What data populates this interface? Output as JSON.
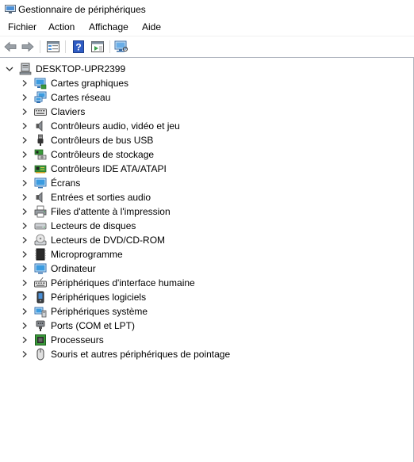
{
  "window": {
    "title": "Gestionnaire de périphériques"
  },
  "menu": [
    {
      "label": "Fichier"
    },
    {
      "label": "Action"
    },
    {
      "label": "Affichage"
    },
    {
      "label": "Aide"
    }
  ],
  "toolbar": {
    "buttons": [
      {
        "icon": "back-arrow-icon"
      },
      {
        "icon": "forward-arrow-icon"
      },
      {
        "icon": "properties-icon"
      },
      {
        "icon": "help-icon"
      },
      {
        "icon": "view-icon"
      },
      {
        "icon": "monitor-scan-icon"
      }
    ]
  },
  "tree": {
    "root": {
      "label": "DESKTOP-UPR2399",
      "expanded": true
    },
    "items": [
      {
        "label": "Cartes graphiques",
        "icon": "display-adapter-icon"
      },
      {
        "label": "Cartes réseau",
        "icon": "network-adapter-icon"
      },
      {
        "label": "Claviers",
        "icon": "keyboard-icon"
      },
      {
        "label": "Contrôleurs audio, vidéo et jeu",
        "icon": "speaker-icon"
      },
      {
        "label": "Contrôleurs de bus USB",
        "icon": "usb-icon"
      },
      {
        "label": "Contrôleurs de stockage",
        "icon": "storage-controller-icon"
      },
      {
        "label": "Contrôleurs IDE ATA/ATAPI",
        "icon": "ide-controller-icon"
      },
      {
        "label": "Écrans",
        "icon": "monitor-icon"
      },
      {
        "label": "Entrées et sorties audio",
        "icon": "audio-io-icon"
      },
      {
        "label": "Files d'attente à l'impression",
        "icon": "printer-icon"
      },
      {
        "label": "Lecteurs de disques",
        "icon": "disk-drive-icon"
      },
      {
        "label": "Lecteurs de DVD/CD-ROM",
        "icon": "dvd-drive-icon"
      },
      {
        "label": "Microprogramme",
        "icon": "firmware-icon"
      },
      {
        "label": "Ordinateur",
        "icon": "computer-icon"
      },
      {
        "label": "Périphériques d'interface humaine",
        "icon": "hid-icon"
      },
      {
        "label": "Périphériques logiciels",
        "icon": "software-device-icon"
      },
      {
        "label": "Périphériques système",
        "icon": "system-device-icon"
      },
      {
        "label": "Ports (COM et LPT)",
        "icon": "port-icon"
      },
      {
        "label": "Processeurs",
        "icon": "processor-icon"
      },
      {
        "label": "Souris et autres périphériques de pointage",
        "icon": "mouse-icon"
      }
    ]
  }
}
